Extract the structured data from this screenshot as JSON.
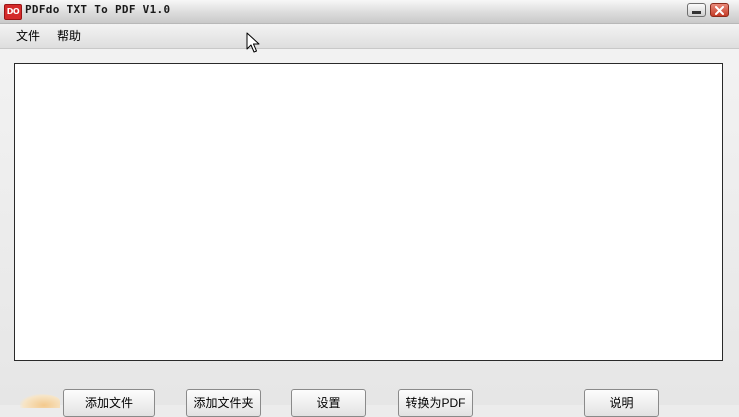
{
  "window": {
    "icon_label": "DO",
    "title": "PDFdo TXT To PDF V1.0"
  },
  "menu": {
    "file": "文件",
    "help": "帮助"
  },
  "buttons": {
    "add_file": "添加文件",
    "add_folder": "添加文件夹",
    "settings": "设置",
    "convert": "转换为PDF",
    "about": "说明"
  },
  "colors": {
    "close_button": "#c43b26",
    "app_icon": "#d42a2a",
    "window_bg": "#ececec"
  },
  "icons": {
    "minimize": "minimize-icon",
    "close": "close-icon",
    "cursor": "mouse-cursor-icon"
  }
}
